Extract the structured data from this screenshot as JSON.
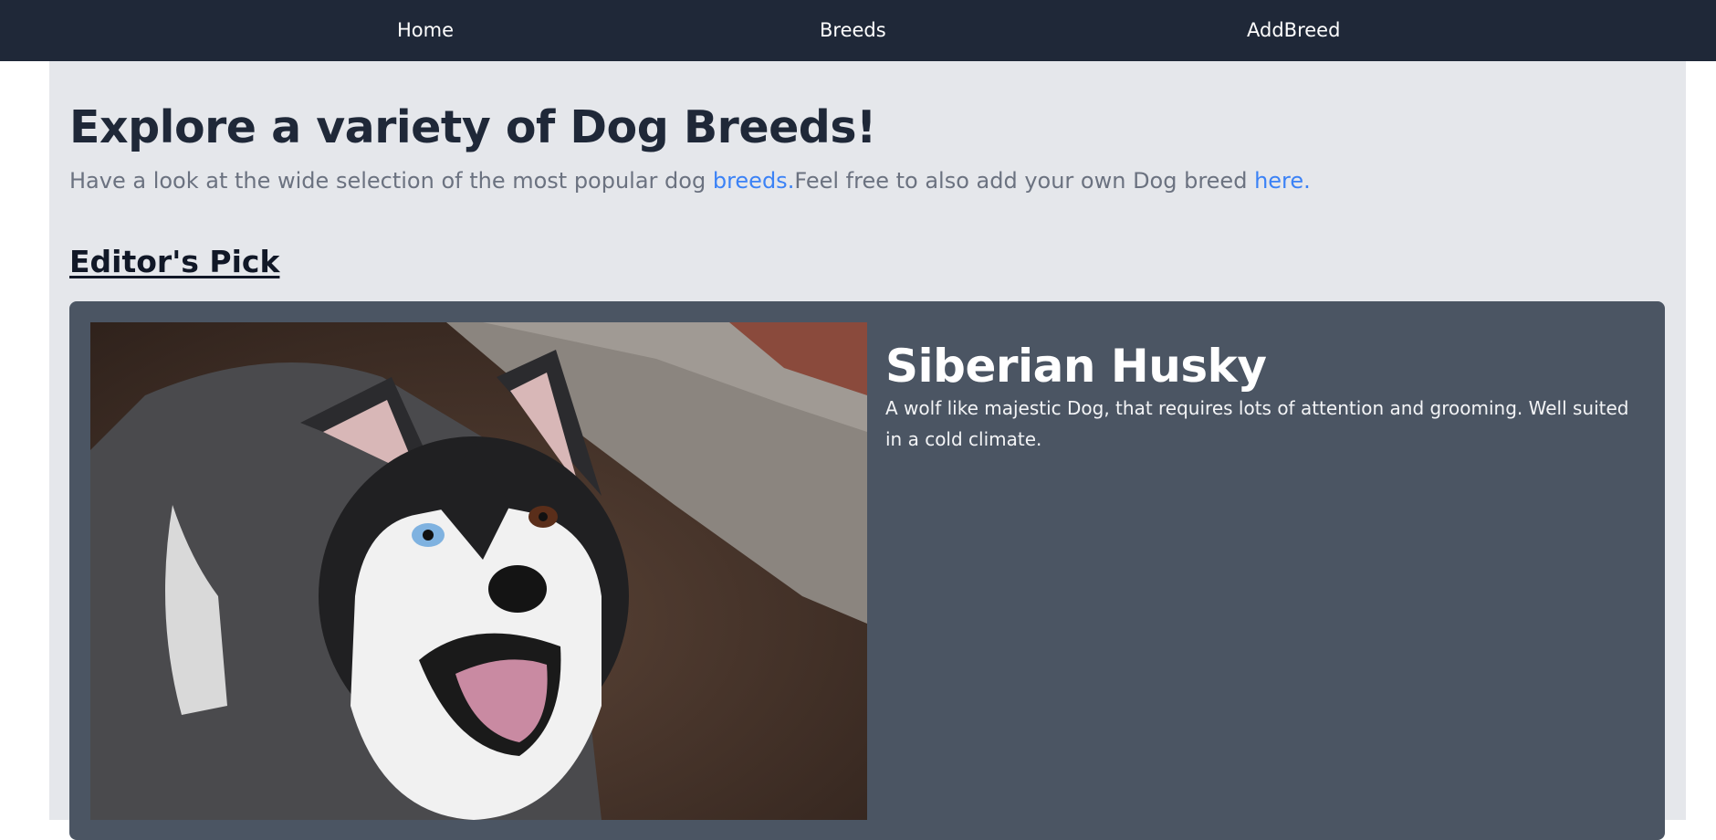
{
  "nav": {
    "items": [
      {
        "label": "Home"
      },
      {
        "label": "Breeds"
      },
      {
        "label": "AddBreed"
      }
    ]
  },
  "hero": {
    "title": "Explore a variety of Dog Breeds!",
    "subtitle_prefix": "Have a look at the wide selection of the most popular dog ",
    "breeds_link": "breeds.",
    "subtitle_middle": "Feel free to also add your own Dog breed ",
    "here_link": "here."
  },
  "editors_pick": {
    "heading": "Editor's Pick",
    "breed_name": "Siberian Husky",
    "description": "A wolf like majestic Dog, that requires lots of attention and grooming. Well suited in a cold climate."
  },
  "colors": {
    "navbar": "#1f2838",
    "page_background": "#e5e7eb",
    "card_background": "#4b5563",
    "link": "#3b82f6"
  }
}
